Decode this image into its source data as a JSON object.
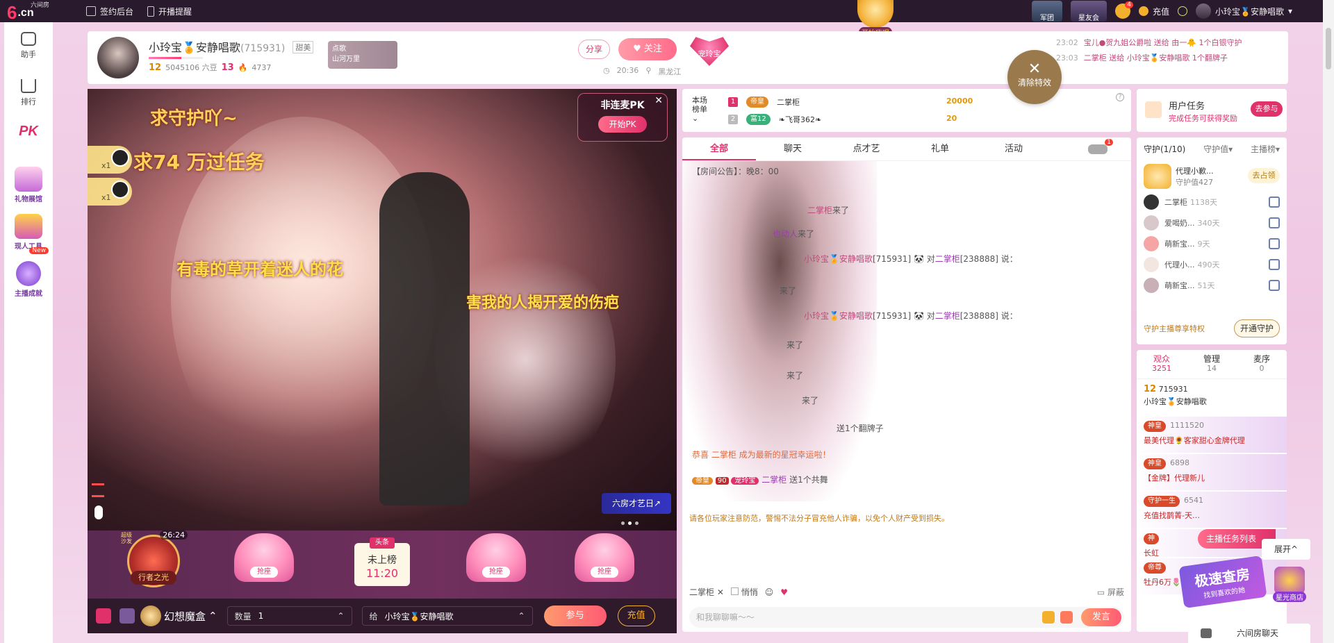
{
  "topbar": {
    "logo_mark": "6",
    "logo_domain": ".cn",
    "logo_sub": "六间房",
    "sign_backend": "签约后台",
    "live_reminder": "开播提醒",
    "start_live": "开始嗨唱",
    "army_badge": "军团",
    "star_club": "星友会",
    "bell_count": "4",
    "recharge": "充值",
    "user_name": "小玲宝🏅安静唱歌"
  },
  "sidebar": [
    {
      "label": "助手"
    },
    {
      "label": "排行"
    },
    {
      "label": "PK"
    },
    {
      "label": "礼物展馆"
    },
    {
      "label": "现人工具"
    },
    {
      "label": "主播成就",
      "tag": "New"
    }
  ],
  "anchor": {
    "name": "小玲宝🏅安静唱歌",
    "room_id": "(715931)",
    "tag": "甜美",
    "wealth_level": "12",
    "beans": "5045106 六豆",
    "star_level": "13",
    "fans": "4737",
    "song_card": {
      "line1": "点歌",
      "line2": "山河万里"
    },
    "share": "分享",
    "follow": "关注",
    "time": "20:36",
    "location": "黑龙江",
    "heart_badge": "宠玲宝"
  },
  "gift_feed": [
    {
      "time": "23:02",
      "text": "宝儿●贺九姐公爵啦 送给 由一🐥 1个白银守护"
    },
    {
      "time": "23:03",
      "text": "二掌柜 送给 小玲宝🏅安静唱歌 1个翻牌子"
    }
  ],
  "clear_fx": {
    "x": "✕",
    "label": "清除特效"
  },
  "video": {
    "lyric1": "求守护吖~",
    "lyric2": "求74 万过任务",
    "lyric3": "有毒的草开着迷人的花",
    "lyric4": "害我的人揭开爱的伤疤",
    "mini_gifts": [
      {
        "count": "x1"
      },
      {
        "count": "x1"
      }
    ],
    "pk_title": "非连麦PK",
    "pk_button": "开始PK",
    "talent_day": "六房才艺日↗"
  },
  "seats": {
    "host_name": "行者之光",
    "host_timer": "26:24",
    "host_side": "超级沙发",
    "grab": "抢座",
    "headline_tag": "头条",
    "headline_status": "未上榜",
    "headline_time": "11:20"
  },
  "giftbar": {
    "gift_name": "幻想魔盒",
    "qty_label": "数量",
    "qty": "1",
    "to_label": "给",
    "to_name": "小玲宝🏅安静唱歌",
    "join": "参与",
    "recharge": "充值"
  },
  "rank": {
    "label_line1": "本场",
    "label_line2": "榜单",
    "rows": [
      {
        "num": "1",
        "badge": "帝皇",
        "name": "二掌柜",
        "score": "20000"
      },
      {
        "num": "2",
        "badge": "富12",
        "name": "❧飞哥362❧",
        "score": "20"
      }
    ]
  },
  "chat": {
    "tabs": [
      "全部",
      "聊天",
      "点才艺",
      "礼单",
      "活动"
    ],
    "car_badge": "1",
    "announcement": "【房间公告】：晚8：00",
    "messages": [
      {
        "user": "二掌柜",
        "text": "来了"
      },
      {
        "user": "也动人",
        "text": "来了"
      },
      {
        "user": "小玲宝🏅安静唱歌",
        "rid": "[715931]",
        "to": "二掌柜",
        "torid": "[238888]",
        "text": "说："
      },
      {
        "user": "",
        "text": "来了"
      },
      {
        "user": "小玲宝🏅安静唱歌",
        "rid": "[715931]",
        "to": "二掌柜",
        "torid": "[238888]",
        "text": "说："
      },
      {
        "user": "",
        "text": "来了"
      },
      {
        "user": "",
        "text": "来了"
      },
      {
        "user": "",
        "text": "来了"
      },
      {
        "user": "",
        "text": "送1个翻牌子"
      },
      {
        "user": "",
        "text": "恭喜 二掌柜 成为最新的星冠幸运啦！"
      },
      {
        "user": "二掌柜",
        "badge": "帝皇",
        "level": "90",
        "badge2": "宠玲宝",
        "text": "送1个共舞"
      }
    ],
    "warning": "请各位玩家注意防范，警惕不法分子冒充他人诈骗，以免个人财产受到损失。",
    "to_user": "二掌柜",
    "whisper": "悄悄",
    "shield": "屏蔽",
    "input_placeholder": "和我聊聊嘛～～",
    "send": "发言"
  },
  "task": {
    "title": "用户任务",
    "subtitle": "完成任务可获得奖励",
    "go": "去参与"
  },
  "guard": {
    "tabs": [
      "守护(1/10)",
      "守护值▾",
      "主播榜▾"
    ],
    "top": {
      "name": "代理小歉...",
      "value": "守护值427",
      "button": "去占领"
    },
    "rows": [
      {
        "name": "二掌柜",
        "days": "1138天"
      },
      {
        "name": "爱喝奶...",
        "days": "340天"
      },
      {
        "name": "萌新宝...",
        "days": "9天"
      },
      {
        "name": "代理小...",
        "days": "490天"
      },
      {
        "name": "萌新宝...",
        "days": "51天"
      }
    ],
    "footer": "守护主播尊享特权",
    "open": "开通守护"
  },
  "audience": {
    "tabs": [
      {
        "label": "观众",
        "count": "3251"
      },
      {
        "label": "管理",
        "count": "14"
      },
      {
        "label": "麦序",
        "count": "0"
      }
    ],
    "me": {
      "level": "12",
      "rid": "715931",
      "name": "小玲宝🏅安静唱歌"
    },
    "viewers": [
      {
        "badge": "神皇",
        "rid": "1111520",
        "name": "最美代理🌻客家甜心金牌代理"
      },
      {
        "badge": "神皇",
        "rid": "6898",
        "name": "【金牌】代理新儿"
      },
      {
        "badge": "守护一生",
        "rid": "6541",
        "name": "充值找鹊菁-天…"
      },
      {
        "badge": "神",
        "rid": "",
        "name": "长虹"
      },
      {
        "badge": "帝尊",
        "rid": "",
        "name": "牡丹6万🌷金牌代理"
      }
    ]
  },
  "floating": {
    "task_list": "主播任务列表",
    "expand": "展开^",
    "promo_title": "极速查房",
    "promo_sub": "找到喜欢的她",
    "shop": "星光商店",
    "room_chat": "六间房聊天"
  }
}
